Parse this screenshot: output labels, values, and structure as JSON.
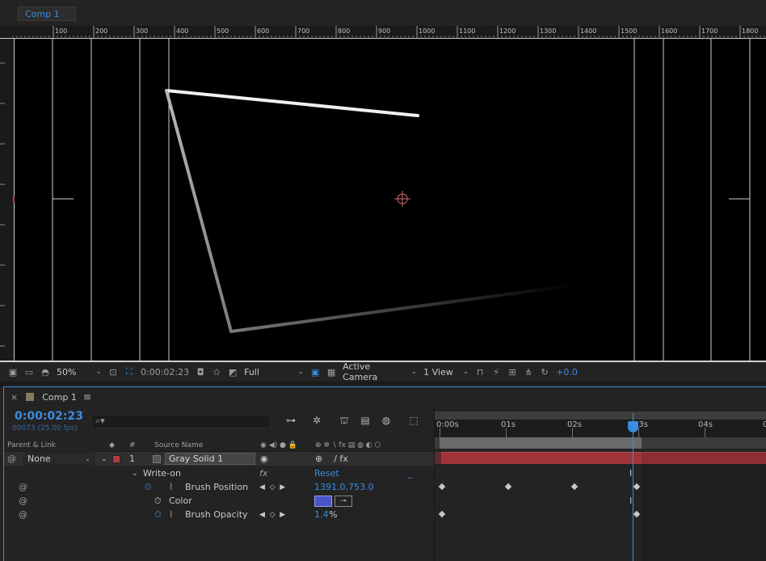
{
  "comp_tab": {
    "label": "Comp 1"
  },
  "ruler": {
    "top_ticks": [
      "100",
      "200",
      "300",
      "400",
      "500",
      "600",
      "700",
      "800",
      "900",
      "1000",
      "1100",
      "1200",
      "1300",
      "1400",
      "1500",
      "1600",
      "1700",
      "1800"
    ]
  },
  "viewer_toolbar": {
    "zoom": "50%",
    "timecode": "0:00:02:23",
    "resolution": "Full",
    "camera": "Active Camera",
    "views": "1 View",
    "exposure": "+0.0"
  },
  "timeline": {
    "panel_title": "Comp 1",
    "current_time": "0:00:02:23",
    "frame_info": "00073 (25.00 fps)",
    "search_placeholder": "",
    "columns": {
      "parent_link": "Parent & Link",
      "number": "#",
      "source_name": "Source Name"
    },
    "layer": {
      "parent": "None",
      "number": "1",
      "name": "Gray Solid 1",
      "label_color": "#b23a3f"
    },
    "effect": {
      "name": "Write-on",
      "fx": "fx",
      "reset": "Reset",
      "reset_trailing": "_"
    },
    "properties": [
      {
        "name": "Brush Position",
        "value": "1391.0,753.0"
      },
      {
        "name": "Color",
        "value": "",
        "swatch": "#4b54c8"
      },
      {
        "name": "Brush Opacity",
        "value": "1.4",
        "unit": "%"
      }
    ],
    "ruler_labels": [
      "0:00s",
      "01s",
      "02s",
      "03s",
      "04s",
      "0"
    ]
  },
  "colors": {
    "accent": "#3b8ce0",
    "layer_bar": "#a03539",
    "stroke": "#e8e8e8"
  }
}
